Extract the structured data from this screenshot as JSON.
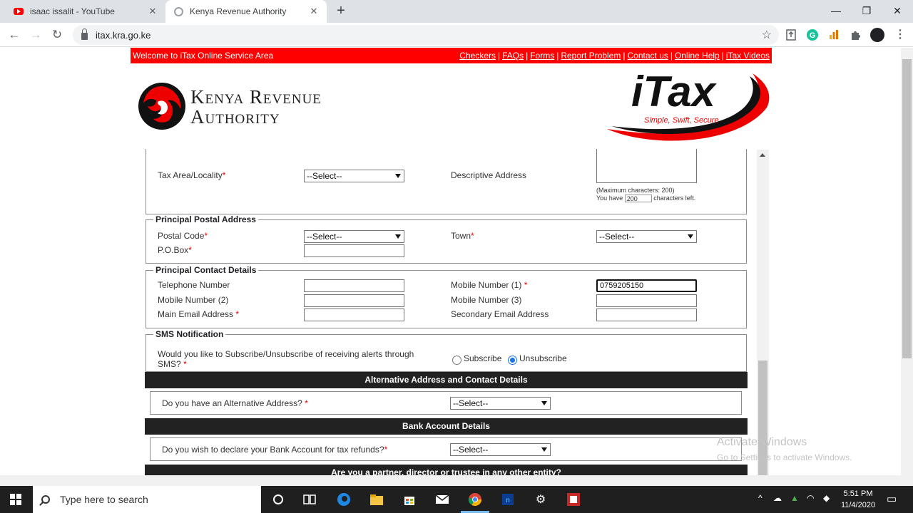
{
  "browser": {
    "tabs": [
      {
        "title": "isaac issalit - YouTube",
        "icon": "youtube-icon",
        "active": false
      },
      {
        "title": "Kenya Revenue Authority",
        "icon": "kra-favicon",
        "active": true
      }
    ],
    "new_tab": "+",
    "controls": {
      "minimize": "—",
      "maximize": "❐",
      "close": "✕"
    },
    "url": "itax.kra.go.ke",
    "nav": {
      "back": "←",
      "forward": "→",
      "reload": "↻"
    },
    "star": "☆",
    "menu": "⋮"
  },
  "header": {
    "welcome": "Welcome to iTax Online Service Area",
    "links": [
      "Checkers",
      "FAQs",
      "Forms",
      "Report Problem",
      "Contact us",
      "Online Help",
      "iTax Videos"
    ],
    "kra_line1": "Kenya Revenue",
    "kra_line2": "Authority",
    "itax_logo": "iTax",
    "itax_tagline": "Simple, Swift, Secure"
  },
  "form": {
    "tax_area_label": "Tax Area/Locality",
    "tax_area_value": "--Select--",
    "descriptive_address_label": "Descriptive Address",
    "max_chars_note": "(Maximum characters: 200)",
    "you_have": "You have",
    "chars_left_value": "200",
    "chars_left_suffix": "characters left.",
    "postal": {
      "legend": "Principal Postal Address",
      "postal_code_label": "Postal Code",
      "postal_code_value": "--Select--",
      "town_label": "Town",
      "town_value": "--Select--",
      "pobox_label": "P.O.Box"
    },
    "contact": {
      "legend": "Principal Contact Details",
      "telephone_label": "Telephone Number",
      "mobile1_label": "Mobile Number (1)",
      "mobile1_value": "0759205150",
      "mobile2_label": "Mobile Number (2)",
      "mobile3_label": "Mobile Number (3)",
      "email_label": "Main Email Address",
      "secondary_email_label": "Secondary Email Address"
    },
    "sms": {
      "legend": "SMS Notification",
      "question_line1": "Would you like to Subscribe/Unsubscribe of receiving alerts through",
      "question_line2": "SMS?",
      "subscribe": "Subscribe",
      "unsubscribe": "Unsubscribe",
      "selected": "Unsubscribe"
    },
    "alt_address": {
      "heading": "Alternative Address and Contact Details",
      "question": "Do you have an Alternative Address?",
      "value": "--Select--"
    },
    "bank": {
      "heading": "Bank Account Details",
      "question": "Do you wish to declare your Bank Account for tax refunds?",
      "value": "--Select--"
    },
    "partner_heading": "Are you a partner, director or trustee in any other entity?",
    "required_mark": "*"
  },
  "watermark": {
    "line1": "Activate Windows",
    "line2": "Go to Settings to activate Windows."
  },
  "taskbar": {
    "search_placeholder": "Type here to search",
    "time": "5:51 PM",
    "date": "11/4/2020"
  },
  "colors": {
    "kra_red": "#ff0000",
    "section_bar": "#222222",
    "taskbar": "#1f1f1f"
  }
}
